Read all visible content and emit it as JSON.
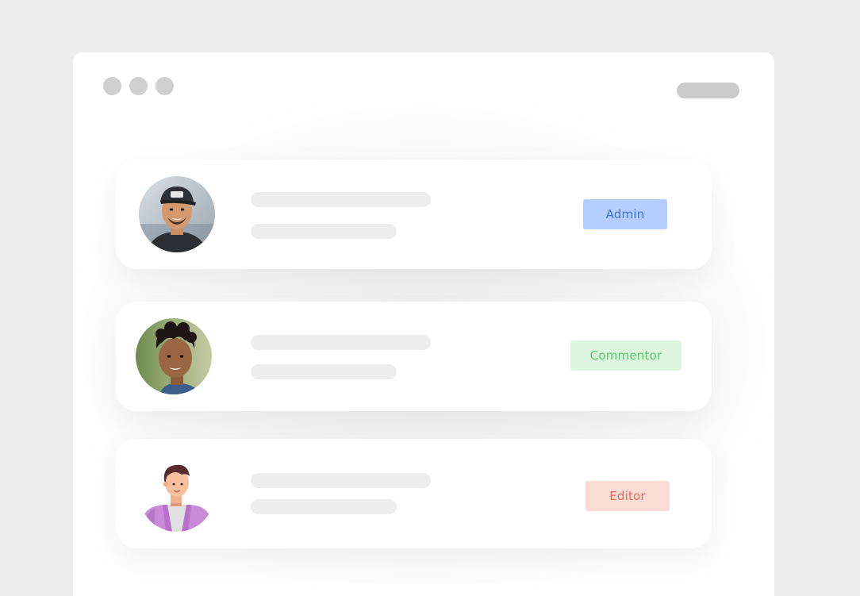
{
  "users": [
    {
      "role": "Admin",
      "avatar": "user-photo-cap",
      "badge_color": "#b4ceff",
      "text_color": "#3f72dc"
    },
    {
      "role": "Commentor",
      "avatar": "user-photo-curly-hair",
      "badge_color": "#dcf5df",
      "text_color": "#5cc66c"
    },
    {
      "role": "Editor",
      "avatar": "user-illustration",
      "badge_color": "#fbdbd6",
      "text_color": "#ea6a57"
    }
  ],
  "colors": {
    "background": "#ededed",
    "window": "#ffffff",
    "skeleton": "#ededed",
    "window_controls": "#cfcfcf"
  }
}
